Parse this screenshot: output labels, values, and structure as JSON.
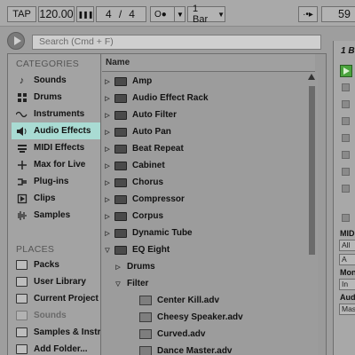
{
  "transport": {
    "tap_label": "TAP",
    "tempo": "120.00",
    "nudge_glyph": "❚❚❚",
    "sig_num": "4",
    "sig_sep": "/",
    "sig_den": "4",
    "metronome_glyph": "O●",
    "quantize": "1 Bar",
    "follow_glyph": "·•▸",
    "position": "59"
  },
  "search": {
    "placeholder": "Search (Cmd + F)"
  },
  "sidebar": {
    "categories_title": "CATEGORIES",
    "categories": [
      {
        "label": "Sounds",
        "icon": "music-note-icon"
      },
      {
        "label": "Drums",
        "icon": "drum-grid-icon"
      },
      {
        "label": "Instruments",
        "icon": "waveform-icon"
      },
      {
        "label": "Audio Effects",
        "icon": "audio-effects-icon",
        "selected": true
      },
      {
        "label": "MIDI Effects",
        "icon": "midi-effects-icon"
      },
      {
        "label": "Max for Live",
        "icon": "max-for-live-icon"
      },
      {
        "label": "Plug-ins",
        "icon": "plugin-icon"
      },
      {
        "label": "Clips",
        "icon": "clip-icon"
      },
      {
        "label": "Samples",
        "icon": "samples-waveform-icon"
      }
    ],
    "places_title": "PLACES",
    "places": [
      {
        "label": "Packs"
      },
      {
        "label": "User Library"
      },
      {
        "label": "Current Project"
      },
      {
        "label": "Sounds",
        "dim": true
      },
      {
        "label": "Samples & Instr"
      },
      {
        "label": "Add Folder..."
      }
    ]
  },
  "browser": {
    "column_name": "Name",
    "items": [
      {
        "label": "Amp",
        "type": "folder",
        "expanded": false,
        "depth": 0
      },
      {
        "label": "Audio Effect Rack",
        "type": "folder",
        "expanded": false,
        "depth": 0
      },
      {
        "label": "Auto Filter",
        "type": "folder",
        "expanded": false,
        "depth": 0
      },
      {
        "label": "Auto Pan",
        "type": "folder",
        "expanded": false,
        "depth": 0
      },
      {
        "label": "Beat Repeat",
        "type": "folder",
        "expanded": false,
        "depth": 0
      },
      {
        "label": "Cabinet",
        "type": "folder",
        "expanded": false,
        "depth": 0
      },
      {
        "label": "Chorus",
        "type": "folder",
        "expanded": false,
        "depth": 0
      },
      {
        "label": "Compressor",
        "type": "folder",
        "expanded": false,
        "depth": 0
      },
      {
        "label": "Corpus",
        "type": "folder",
        "expanded": false,
        "depth": 0
      },
      {
        "label": "Dynamic Tube",
        "type": "folder",
        "expanded": false,
        "depth": 0
      },
      {
        "label": "EQ Eight",
        "type": "folder",
        "expanded": true,
        "depth": 0
      },
      {
        "label": "Drums",
        "type": "subfolder",
        "expanded": false,
        "depth": 1
      },
      {
        "label": "Filter",
        "type": "subfolder",
        "expanded": true,
        "depth": 1
      },
      {
        "label": "Center Kill.adv",
        "type": "file",
        "depth": 2
      },
      {
        "label": "Cheesy Speaker.adv",
        "type": "file",
        "depth": 2
      },
      {
        "label": "Curved.adv",
        "type": "file",
        "depth": 2
      },
      {
        "label": "Dance Master.adv",
        "type": "file",
        "depth": 2
      }
    ]
  },
  "rpanel": {
    "title": "1 B",
    "midi_label": "MID",
    "all_value": "All",
    "a_value": "A",
    "mon_label": "Mon",
    "in_value": "In",
    "aud_label": "Aud",
    "mas_value": "Mas"
  }
}
